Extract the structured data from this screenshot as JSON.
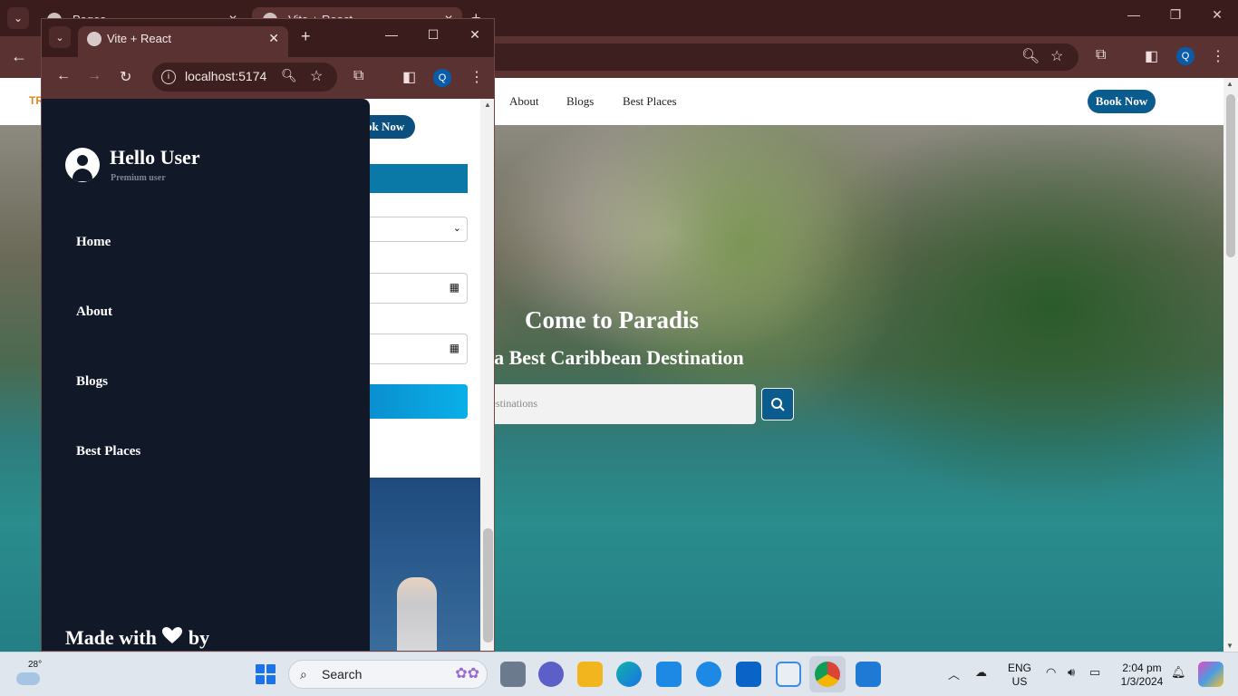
{
  "background_window": {
    "tabs": [
      {
        "title": "Pages"
      },
      {
        "title": "Vite + React"
      }
    ],
    "nav": {
      "links": [
        "About",
        "Blogs",
        "Best Places"
      ],
      "book_now": "Book Now"
    },
    "hero": {
      "title": "Come to Paradis",
      "subtitle": "ica Best Caribbean Destination",
      "search_placeholder": "h Destinations"
    }
  },
  "foreground_window": {
    "tab_title": "Vite + React",
    "url": "localhost:5174",
    "profile_initial": "Q",
    "page": {
      "book_now": "ok Now"
    },
    "drawer": {
      "greeting": "Hello User",
      "role": "Premium user",
      "menu": [
        "Home",
        "About",
        "Blogs",
        "Best Places"
      ],
      "footer": "Made with",
      "footer_suffix": "by"
    }
  },
  "taskbar": {
    "weather_temp": "28°",
    "search_label": "Search",
    "language": "ENG",
    "region": "US",
    "time": "2:04 pm",
    "date": "1/3/2024",
    "apps": [
      "file-explorer",
      "edge",
      "hp",
      "tips",
      "outlook",
      "store",
      "chrome",
      "vscode"
    ]
  },
  "colors": {
    "drawer_bg": "#111827",
    "accent": "#0b5c8e",
    "browser_frame": "#5a3232"
  }
}
